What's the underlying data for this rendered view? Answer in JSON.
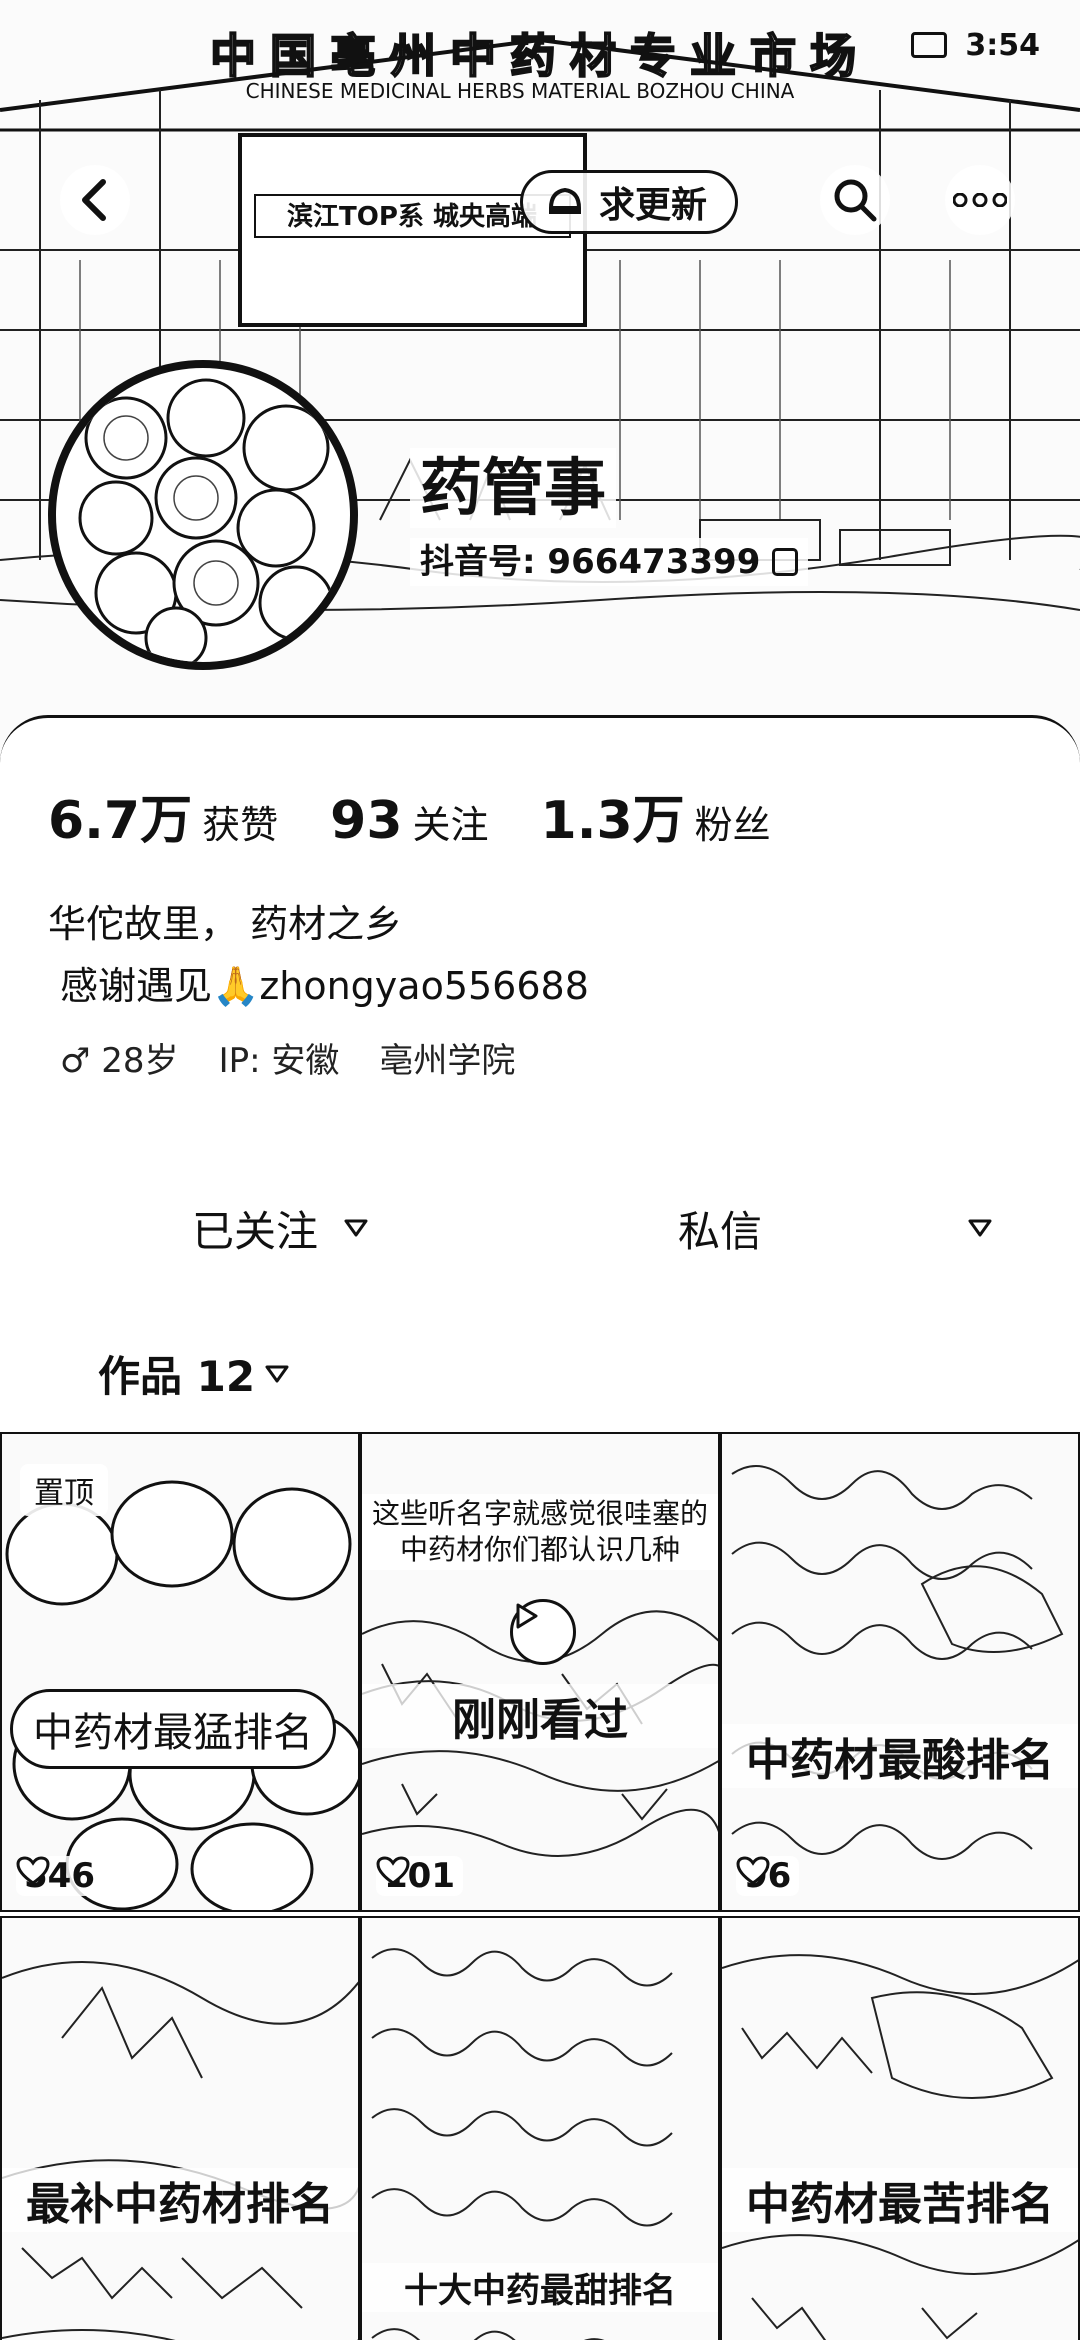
{
  "status_bar": {
    "time": "3:54"
  },
  "banner": {
    "sign_text": "中国亳州中药材专业市场",
    "sign_sub": "CHINESE MEDICINAL HERBS MATERIAL BOZHOU CHINA",
    "billboard": "滨江TOP系 城央高端"
  },
  "top_nav": {
    "back_icon": "back-arrow-icon",
    "update_label": "求更新",
    "search_icon": "search-icon",
    "more_icon": "more-dots-icon"
  },
  "profile": {
    "name": "药管事",
    "douyin_id": "抖音号: 966473399"
  },
  "stats": [
    {
      "num": "6.7万",
      "label": "获赞"
    },
    {
      "num": "93",
      "label": "关注"
    },
    {
      "num": "1.3万",
      "label": "粉丝"
    }
  ],
  "bio": {
    "line1": "华佗故里， 药材之乡",
    "line2": "感谢遇见🙏zhongyao556688"
  },
  "meta": {
    "gender_age": "♂ 28岁",
    "ip": "IP:  安徽",
    "school": "亳州学院"
  },
  "actions": {
    "follow_label": "已关注",
    "message_label": "私信"
  },
  "works_tab": {
    "label": "作品 12"
  },
  "grid": [
    {
      "pin": "置顶",
      "title": "中药材最猛排名",
      "likes": "546"
    },
    {
      "caption": "这些听名字就感觉很哇塞的中药材你们都认识几种",
      "watched": "刚刚看过",
      "likes": "101"
    },
    {
      "title": "中药材最酸排名",
      "likes": "96"
    },
    {
      "title": "最补中药材排名"
    },
    {
      "title": "十大中药最甜排名"
    },
    {
      "title": "中药材最苦排名"
    }
  ]
}
